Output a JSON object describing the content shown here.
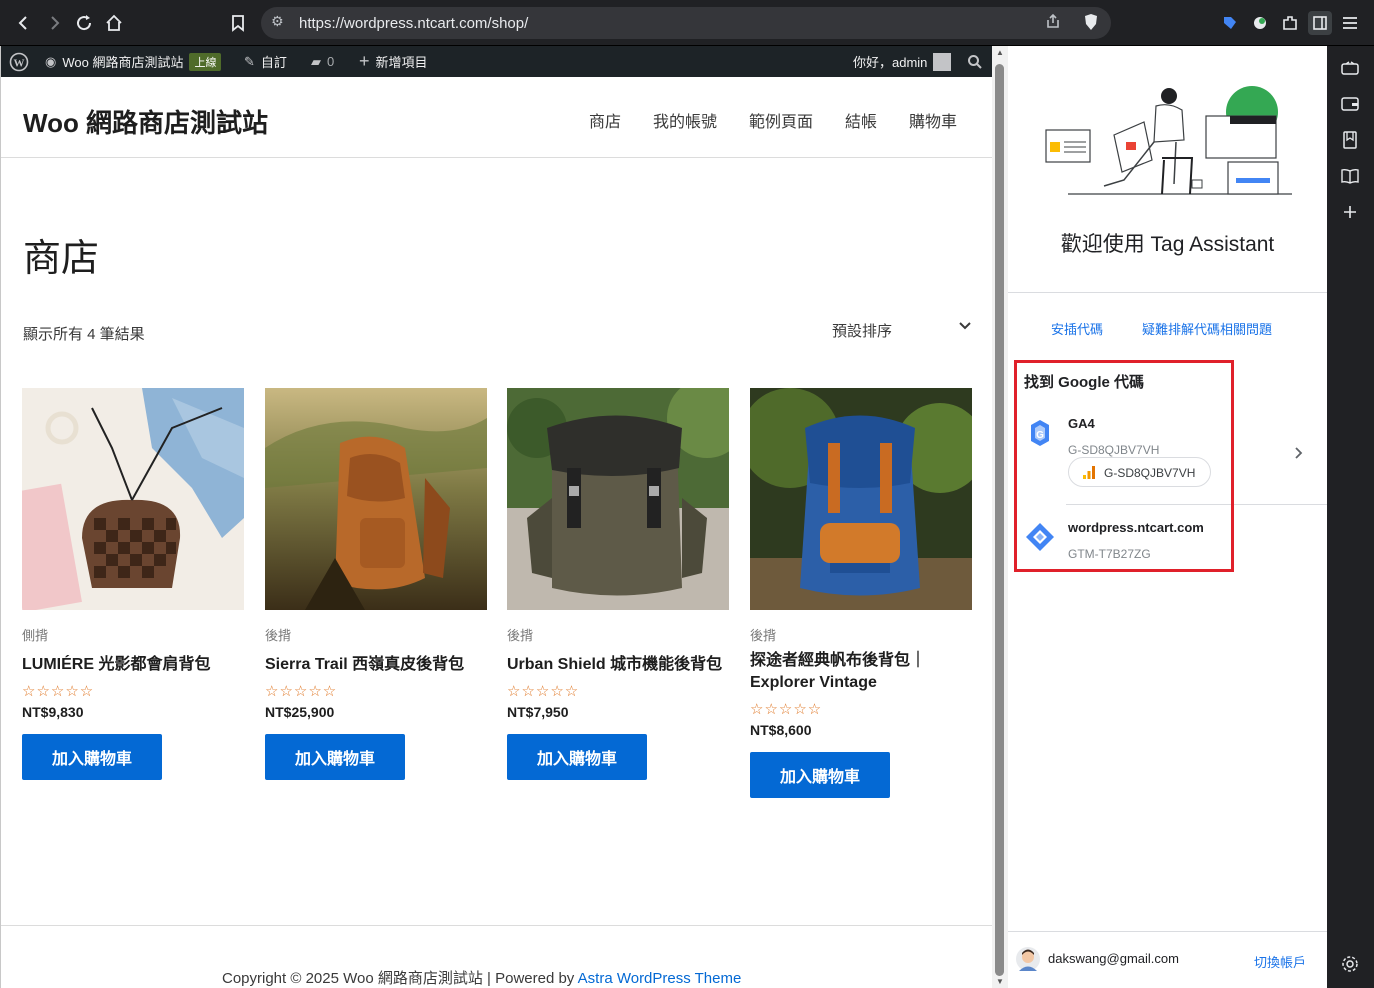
{
  "browser": {
    "url": "https://wordpress.ntcart.com/shop/"
  },
  "adminbar": {
    "site_name": "Woo 網路商店測試站",
    "live_badge": "上線",
    "customize": "自訂",
    "comments_count": "0",
    "new_item": "新增項目",
    "greeting": "你好，admin"
  },
  "site": {
    "title": "Woo 網路商店測試站",
    "nav": [
      "商店",
      "我的帳號",
      "範例頁面",
      "結帳",
      "購物車"
    ],
    "page_title": "商店",
    "results": "顯示所有 4 筆結果",
    "sort": "預設排序",
    "products": [
      {
        "category": "側揹",
        "name": "LUMIÉRE 光影都會肩背包",
        "price": "NT$9,830",
        "button": "加入購物車"
      },
      {
        "category": "後揹",
        "name": "Sierra Trail 西嶺真皮後背包",
        "price": "NT$25,900",
        "button": "加入購物車"
      },
      {
        "category": "後揹",
        "name": "Urban Shield 城市機能後背包",
        "price": "NT$7,950",
        "button": "加入購物車"
      },
      {
        "category": "後揹",
        "name": "探途者經典帆布後背包｜Explorer Vintage",
        "price": "NT$8,600",
        "button": "加入購物車"
      }
    ],
    "rating_stars": "☆☆☆☆☆",
    "footer": {
      "copyright": "Copyright © 2025 Woo 網路商店測試站 | Powered by ",
      "theme_link": "Astra WordPress Theme"
    }
  },
  "tag_assistant": {
    "welcome": "歡迎使用 Tag Assistant",
    "install_link": "安插代碼",
    "troubleshoot_link": "疑難排解代碼相關問題",
    "found_heading": "找到 Google 代碼",
    "tags": [
      {
        "name": "GA4",
        "id": "G-SD8QJBV7VH",
        "chip": "G-SD8QJBV7VH"
      },
      {
        "name": "wordpress.ntcart.com",
        "id": "GTM-T7B27ZG"
      }
    ],
    "account_email": "dakswang@gmail.com",
    "switch_account": "切換帳戶"
  },
  "colors": {
    "wp_blue": "#0469d4",
    "highlight_red": "#e0202a",
    "google_blue": "#1a73e8",
    "admin_bar": "#1d2327",
    "browser_chrome": "#202124"
  }
}
